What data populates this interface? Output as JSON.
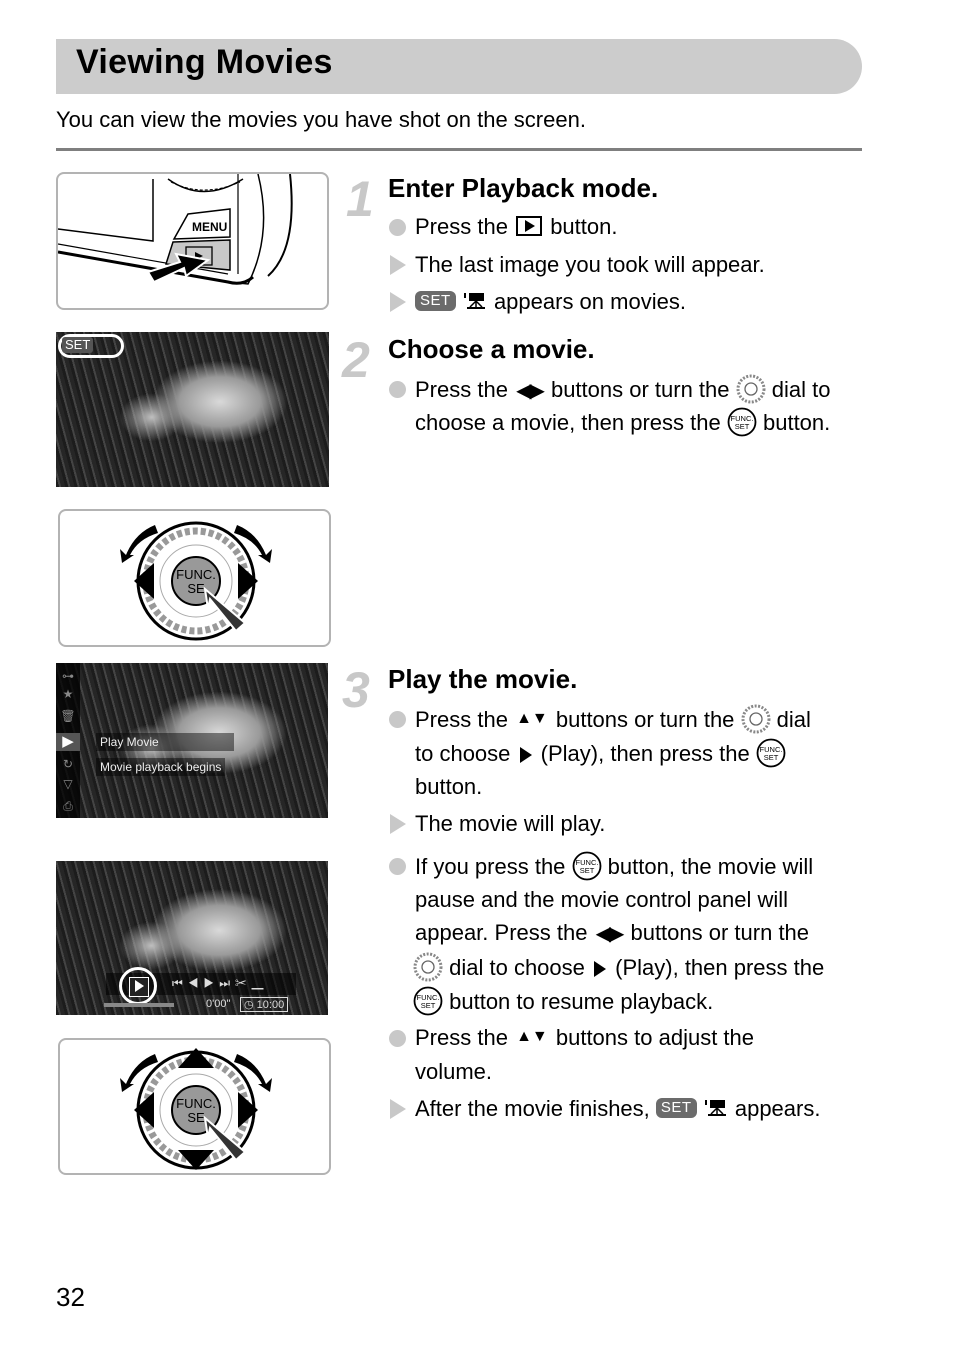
{
  "page": {
    "title": "Viewing Movies",
    "intro": "You can view the movies you have shot on the screen.",
    "page_number": "32"
  },
  "steps": [
    {
      "number": "1",
      "title": "Enter Playback mode.",
      "lines": [
        {
          "type": "action",
          "before": "Press the",
          "icon": "playback-button-icon",
          "after": "button."
        },
        {
          "type": "result",
          "text": "The last image you took will appear."
        },
        {
          "type": "result",
          "badge": "SET",
          "icon": "movie-icon",
          "after": "appears on movies."
        }
      ],
      "illustration": {
        "label": "MENU",
        "description": "camera-back-playback-button"
      }
    },
    {
      "number": "2",
      "title": "Choose a movie.",
      "lines": [
        {
          "type": "action",
          "l1_a": "Press the",
          "l1_b": "buttons or turn the",
          "l1_c": "dial to",
          "l2_a": "choose a movie, then press the",
          "l2_b": "button."
        }
      ],
      "photo_badge": "SET",
      "dial_label": "FUNC.\nSET"
    },
    {
      "number": "3",
      "title": "Play the movie.",
      "lines": [
        {
          "type": "action",
          "l1_a": "Press the",
          "l1_b": "buttons or turn the",
          "l1_c": "dial",
          "l2_a": "to choose",
          "l2_b": "(Play), then press the",
          "l3": "button."
        },
        {
          "type": "result",
          "text": "The movie will play."
        },
        {
          "type": "action",
          "l1_a": "If you press the",
          "l1_b": "button, the movie will",
          "l2": "pause and the movie control panel will",
          "l3_a": "appear. Press the",
          "l3_b": "buttons or turn the",
          "l4_a": "dial to choose",
          "l4_b": "(Play), then press the",
          "l5": "button to resume playback."
        },
        {
          "type": "action",
          "l1_a": "Press the",
          "l1_b": "buttons to adjust the",
          "l2": "volume."
        },
        {
          "type": "result",
          "a": "After the movie finishes,",
          "badge": "SET",
          "b": "appears."
        }
      ],
      "menu_photo": {
        "items": [
          "Play Movie",
          "Movie playback begins"
        ]
      },
      "control_panel": {
        "elapsed": "0'00\"",
        "total": "10:00"
      }
    }
  ],
  "icons": {
    "up_down": "▲▼",
    "left_right": "◀▶",
    "func_set": "FUNC. SET"
  }
}
